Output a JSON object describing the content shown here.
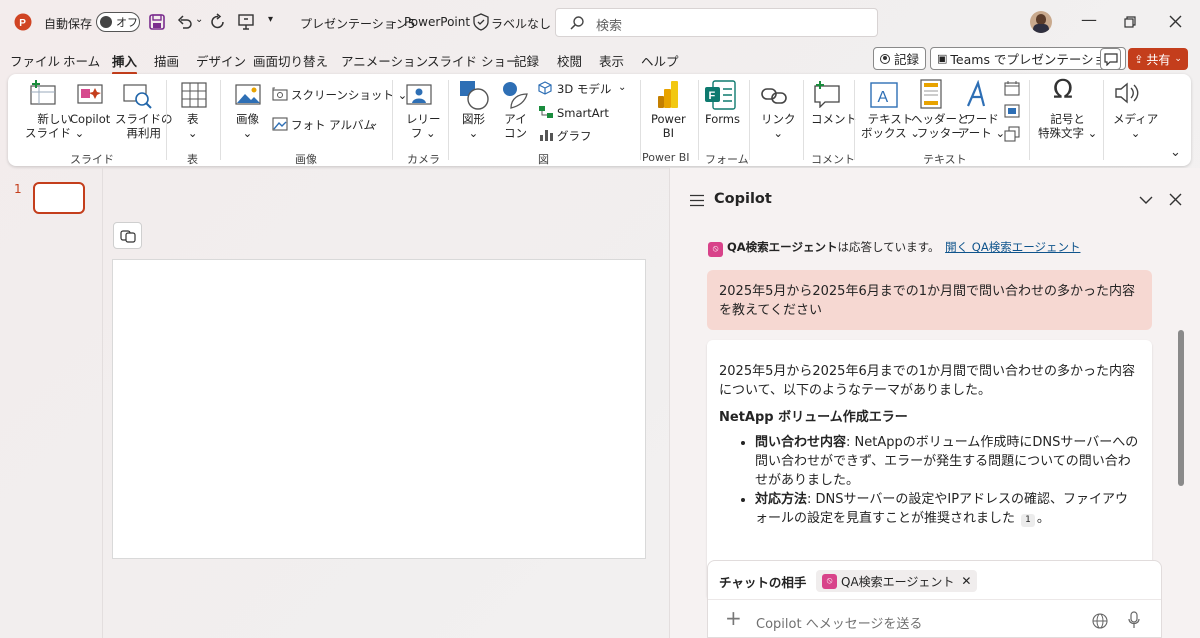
{
  "titlebar": {
    "autosave_label": "自動保存",
    "autosave_state": "オフ",
    "doc_title": "プレゼンテーション5",
    "separator": "-",
    "app_name": "PowerPoint",
    "sensitivity": "ラベルなし",
    "search_placeholder": "検索"
  },
  "tabs": [
    "ファイル",
    "ホーム",
    "挿入",
    "描画",
    "デザイン",
    "画面切り替え",
    "アニメーション",
    "スライド ショー",
    "記録",
    "校閲",
    "表示",
    "ヘルプ"
  ],
  "active_tab": "挿入",
  "actions": {
    "record": "記録",
    "teams": "Teams でプレゼンテーション",
    "share": "共有"
  },
  "ribbon": {
    "slide": {
      "new_slide_1": "新しい",
      "new_slide_2": "スライド",
      "copilot": "Copilot",
      "reuse_1": "スライドの",
      "reuse_2": "再利用",
      "group": "スライド"
    },
    "table": {
      "label": "表",
      "group": "表"
    },
    "images": {
      "image": "画像",
      "screenshot": "スクリーンショット",
      "photo_album": "フォト アルバム",
      "group": "画像"
    },
    "camera": {
      "label_1": "レリー",
      "label_2": "フ",
      "group": "カメラ"
    },
    "illustrations": {
      "shapes": "図形",
      "icons_1": "アイ",
      "icons_2": "コン",
      "model3d": "3D モデル",
      "smartart": "SmartArt",
      "chart": "グラフ",
      "group": "図"
    },
    "powerbi": {
      "label_1": "Power",
      "label_2": "BI",
      "group": "Power BI"
    },
    "forms": {
      "label": "Forms",
      "group": "フォーム"
    },
    "links": {
      "label": "リンク"
    },
    "comments": {
      "label": "コメント",
      "group": "コメント"
    },
    "text": {
      "textbox_1": "テキスト",
      "textbox_2": "ボックス",
      "header_1": "ヘッダーと",
      "header_2": "フッター",
      "wordart_1": "ワード",
      "wordart_2": "アート",
      "group": "テキスト"
    },
    "symbols": {
      "label_1": "記号と",
      "label_2": "特殊文字"
    },
    "media": {
      "label": "メディア"
    }
  },
  "thumbnail": {
    "number": "1"
  },
  "copilot": {
    "title": "Copilot",
    "agent_notice": "QA検索エージェント",
    "agent_notice_suffix": "は応答しています。",
    "agent_link": "開く QA検索エージェント",
    "user_message": "2025年5月から2025年6月までの1か月間で問い合わせの多かった内容を教えてください",
    "response_intro": "2025年5月から2025年6月までの1か月間で問い合わせの多かった内容について、以下のようなテーマがありました。",
    "response_heading": "NetApp ボリューム作成エラー",
    "bullet1_label": "問い合わせ内容",
    "bullet1_text": ": NetAppのボリューム作成時にDNSサーバーへの問い合わせができず、エラーが発生する問題についての問い合わせがありました。",
    "bullet2_label": "対応方法",
    "bullet2_text": ": DNSサーバーの設定やIPアドレスの確認、ファイアウォールの設定を見直すことが推奨されました",
    "citation": "1",
    "bullet2_end": "。",
    "chat_partner_label": "チャットの相手",
    "chat_partner_agent": "QA検索エージェント",
    "input_placeholder": "Copilot へメッセージを送る"
  }
}
